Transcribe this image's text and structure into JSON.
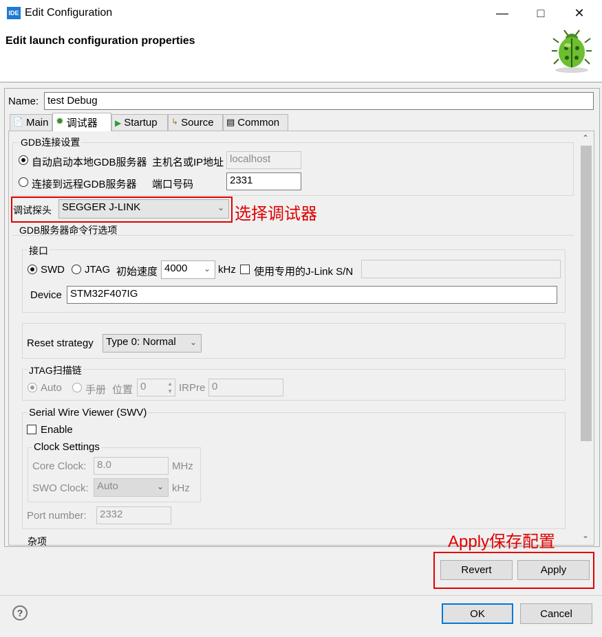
{
  "window": {
    "icon_text": "IDE",
    "title": "Edit Configuration"
  },
  "header": {
    "title": "Edit launch configuration properties"
  },
  "name_label": "Name:",
  "name_value": "test Debug",
  "tabs": [
    {
      "label": "Main",
      "icon": "document-icon"
    },
    {
      "label": "调试器",
      "icon": "bug-icon"
    },
    {
      "label": "Startup",
      "icon": "play-icon"
    },
    {
      "label": "Source",
      "icon": "source-icon"
    },
    {
      "label": "Common",
      "icon": "common-icon"
    }
  ],
  "gdb_connection": {
    "label": "GDB连接设置",
    "auto_start": "自动启动本地GDB服务器",
    "host_label": "主机名或IP地址",
    "host_value": "localhost",
    "remote": "连接到远程GDB服务器",
    "port_label": "端口号码",
    "port_value": "2331"
  },
  "probe": {
    "label": "调试探头",
    "value": "SEGGER J-LINK"
  },
  "annotation_probe": "选择调试器",
  "gdb_server_options": "GDB服务器命令行选项",
  "interface": {
    "label": "接口",
    "swd": "SWD",
    "jtag": "JTAG",
    "speed_label": "初始速度",
    "speed_value": "4000",
    "speed_unit": "kHz",
    "jlink_sn_label": "使用专用的J-Link S/N",
    "device_label": "Device",
    "device_value": "STM32F407IG"
  },
  "reset": {
    "label": "Reset strategy",
    "value": "Type 0: Normal"
  },
  "jtag_chain": {
    "label": "JTAG扫描链",
    "auto": "Auto",
    "manual": "手册",
    "position_label": "位置",
    "position_value": "0",
    "irpre_label": "IRPre",
    "irpre_value": "0"
  },
  "swv": {
    "label": "Serial Wire Viewer (SWV)",
    "enable": "Enable",
    "clock_settings": "Clock Settings",
    "core_clock_label": "Core Clock:",
    "core_clock_value": "8.0",
    "core_clock_unit": "MHz",
    "swo_clock_label": "SWO Clock:",
    "swo_clock_value": "Auto",
    "swo_clock_unit": "kHz",
    "port_label": "Port number:",
    "port_value": "2332"
  },
  "misc_label": "杂项",
  "annotation_apply": "Apply保存配置",
  "buttons": {
    "revert": "Revert",
    "apply": "Apply",
    "ok": "OK",
    "cancel": "Cancel"
  },
  "help_icon_text": "?",
  "colors": {
    "annotation_red": "#e00000",
    "focus_blue": "#0078d7"
  }
}
